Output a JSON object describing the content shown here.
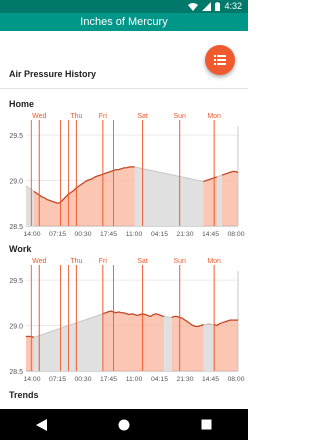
{
  "status": {
    "time": "4:32"
  },
  "app_title": "Inches of Mercury",
  "section_title": "Air Pressure History",
  "trends_title": "Trends",
  "icons": {
    "fab": "list-icon",
    "wifi": "wifi-icon",
    "signal": "cell-signal-icon",
    "battery": "battery-icon",
    "back": "back-icon",
    "home": "home-icon",
    "recents": "recents-icon"
  },
  "colors": {
    "accent": "#ef5a2e",
    "appbar": "#009688",
    "statusbar": "#00796b",
    "fill": "#f9b49b",
    "line": "#c0441f",
    "gap_fill": "#e0e0e0"
  },
  "chart_data": [
    {
      "type": "area",
      "title": "Home",
      "ylim": [
        28.5,
        29.6
      ],
      "yticks": [
        "28.5",
        "29.0",
        "29.5"
      ],
      "x_labels": [
        "14:00",
        "07:15",
        "00:30",
        "17:45",
        "11:00",
        "04:15",
        "21:30",
        "14:45",
        "08:00"
      ],
      "day_labels": [
        "Wed",
        "Thu",
        "Fri",
        "Sat",
        "Sun",
        "Mon"
      ],
      "x": [
        0,
        1,
        2,
        3,
        4,
        5,
        6,
        7,
        8,
        9,
        10,
        11,
        12,
        13,
        14,
        15,
        16,
        17,
        18,
        19,
        20,
        21,
        22,
        23,
        24,
        25,
        26,
        27,
        28,
        29,
        30,
        31,
        32,
        33,
        34,
        35,
        36,
        37,
        38,
        39,
        40,
        41,
        42,
        43,
        44,
        45,
        46,
        47,
        48,
        49,
        50,
        51,
        52,
        53,
        54,
        55,
        56,
        57,
        58,
        59,
        60,
        61,
        62,
        63,
        64,
        65,
        66,
        67,
        68,
        69,
        70,
        71,
        72,
        73,
        74,
        75,
        76,
        77,
        78,
        79,
        80
      ],
      "values": [
        28.94,
        28.92,
        28.9,
        28.88,
        28.86,
        28.84,
        28.82,
        28.81,
        28.79,
        28.78,
        28.77,
        28.76,
        28.75,
        28.76,
        28.79,
        28.82,
        28.85,
        28.87,
        28.89,
        28.92,
        28.94,
        28.96,
        28.98,
        29.0,
        29.01,
        29.02,
        29.04,
        29.05,
        29.06,
        29.07,
        29.08,
        29.09,
        29.1,
        29.11,
        29.12,
        29.12,
        29.13,
        29.14,
        29.14,
        29.15,
        29.15,
        29.15,
        29.14,
        29.13,
        29.12,
        29.11,
        29.1,
        29.09,
        29.08,
        29.07,
        29.06,
        29.05,
        29.04,
        29.03,
        29.02,
        29.01,
        29.0,
        28.99,
        28.98,
        28.97,
        28.96,
        28.95,
        28.95,
        28.96,
        28.96,
        28.97,
        28.98,
        28.99,
        29.0,
        29.01,
        29.02,
        29.03,
        29.04,
        29.05,
        29.06,
        29.07,
        29.08,
        29.09,
        29.1,
        29.1,
        29.09
      ],
      "gaps": [
        [
          0,
          3
        ],
        [
          41,
          67
        ],
        [
          72,
          74
        ]
      ],
      "day_markers": [
        5,
        19,
        29,
        44,
        58,
        71
      ],
      "extra_lines": [
        2,
        13,
        16,
        33
      ]
    },
    {
      "type": "area",
      "title": "Work",
      "ylim": [
        28.5,
        29.6
      ],
      "yticks": [
        "28.5",
        "29.0",
        "29.5"
      ],
      "x_labels": [
        "14:00",
        "07:15",
        "00:30",
        "17:45",
        "11:00",
        "04:15",
        "21:30",
        "14:45",
        "08:00"
      ],
      "day_labels": [
        "Wed",
        "Thu",
        "Fri",
        "Sat",
        "Sun",
        "Mon"
      ],
      "x": [
        0,
        1,
        2,
        3,
        4,
        5,
        6,
        7,
        8,
        9,
        10,
        11,
        12,
        13,
        14,
        15,
        16,
        17,
        18,
        19,
        20,
        21,
        22,
        23,
        24,
        25,
        26,
        27,
        28,
        29,
        30,
        31,
        32,
        33,
        34,
        35,
        36,
        37,
        38,
        39,
        40,
        41,
        42,
        43,
        44,
        45,
        46,
        47,
        48,
        49,
        50,
        51,
        52,
        53,
        54,
        55,
        56,
        57,
        58,
        59,
        60,
        61,
        62,
        63,
        64,
        65,
        66,
        67,
        68,
        69,
        70,
        71,
        72,
        73,
        74,
        75,
        76,
        77,
        78,
        79,
        80
      ],
      "values": [
        28.88,
        28.88,
        28.88,
        28.87,
        28.88,
        28.89,
        28.9,
        28.91,
        28.92,
        28.93,
        28.94,
        28.95,
        28.96,
        28.97,
        28.98,
        28.99,
        29.0,
        29.01,
        29.02,
        29.03,
        29.04,
        29.05,
        29.06,
        29.07,
        29.08,
        29.09,
        29.1,
        29.11,
        29.12,
        29.13,
        29.14,
        29.15,
        29.16,
        29.15,
        29.14,
        29.15,
        29.14,
        29.14,
        29.13,
        29.12,
        29.13,
        29.12,
        29.11,
        29.12,
        29.13,
        29.12,
        29.11,
        29.1,
        29.12,
        29.13,
        29.12,
        29.11,
        29.1,
        29.09,
        29.08,
        29.09,
        29.1,
        29.1,
        29.09,
        29.08,
        29.06,
        29.04,
        29.02,
        29.0,
        28.99,
        28.99,
        29.0,
        29.01,
        29.02,
        29.03,
        29.02,
        29.01,
        29.0,
        29.02,
        29.03,
        29.04,
        29.05,
        29.06,
        29.06,
        29.06,
        29.06
      ],
      "gaps": [
        [
          3,
          29
        ],
        [
          52,
          55
        ],
        [
          67,
          71
        ]
      ],
      "day_markers": [
        5,
        19,
        29,
        44,
        58,
        71
      ],
      "extra_lines": [
        2,
        13,
        16,
        33
      ]
    }
  ]
}
